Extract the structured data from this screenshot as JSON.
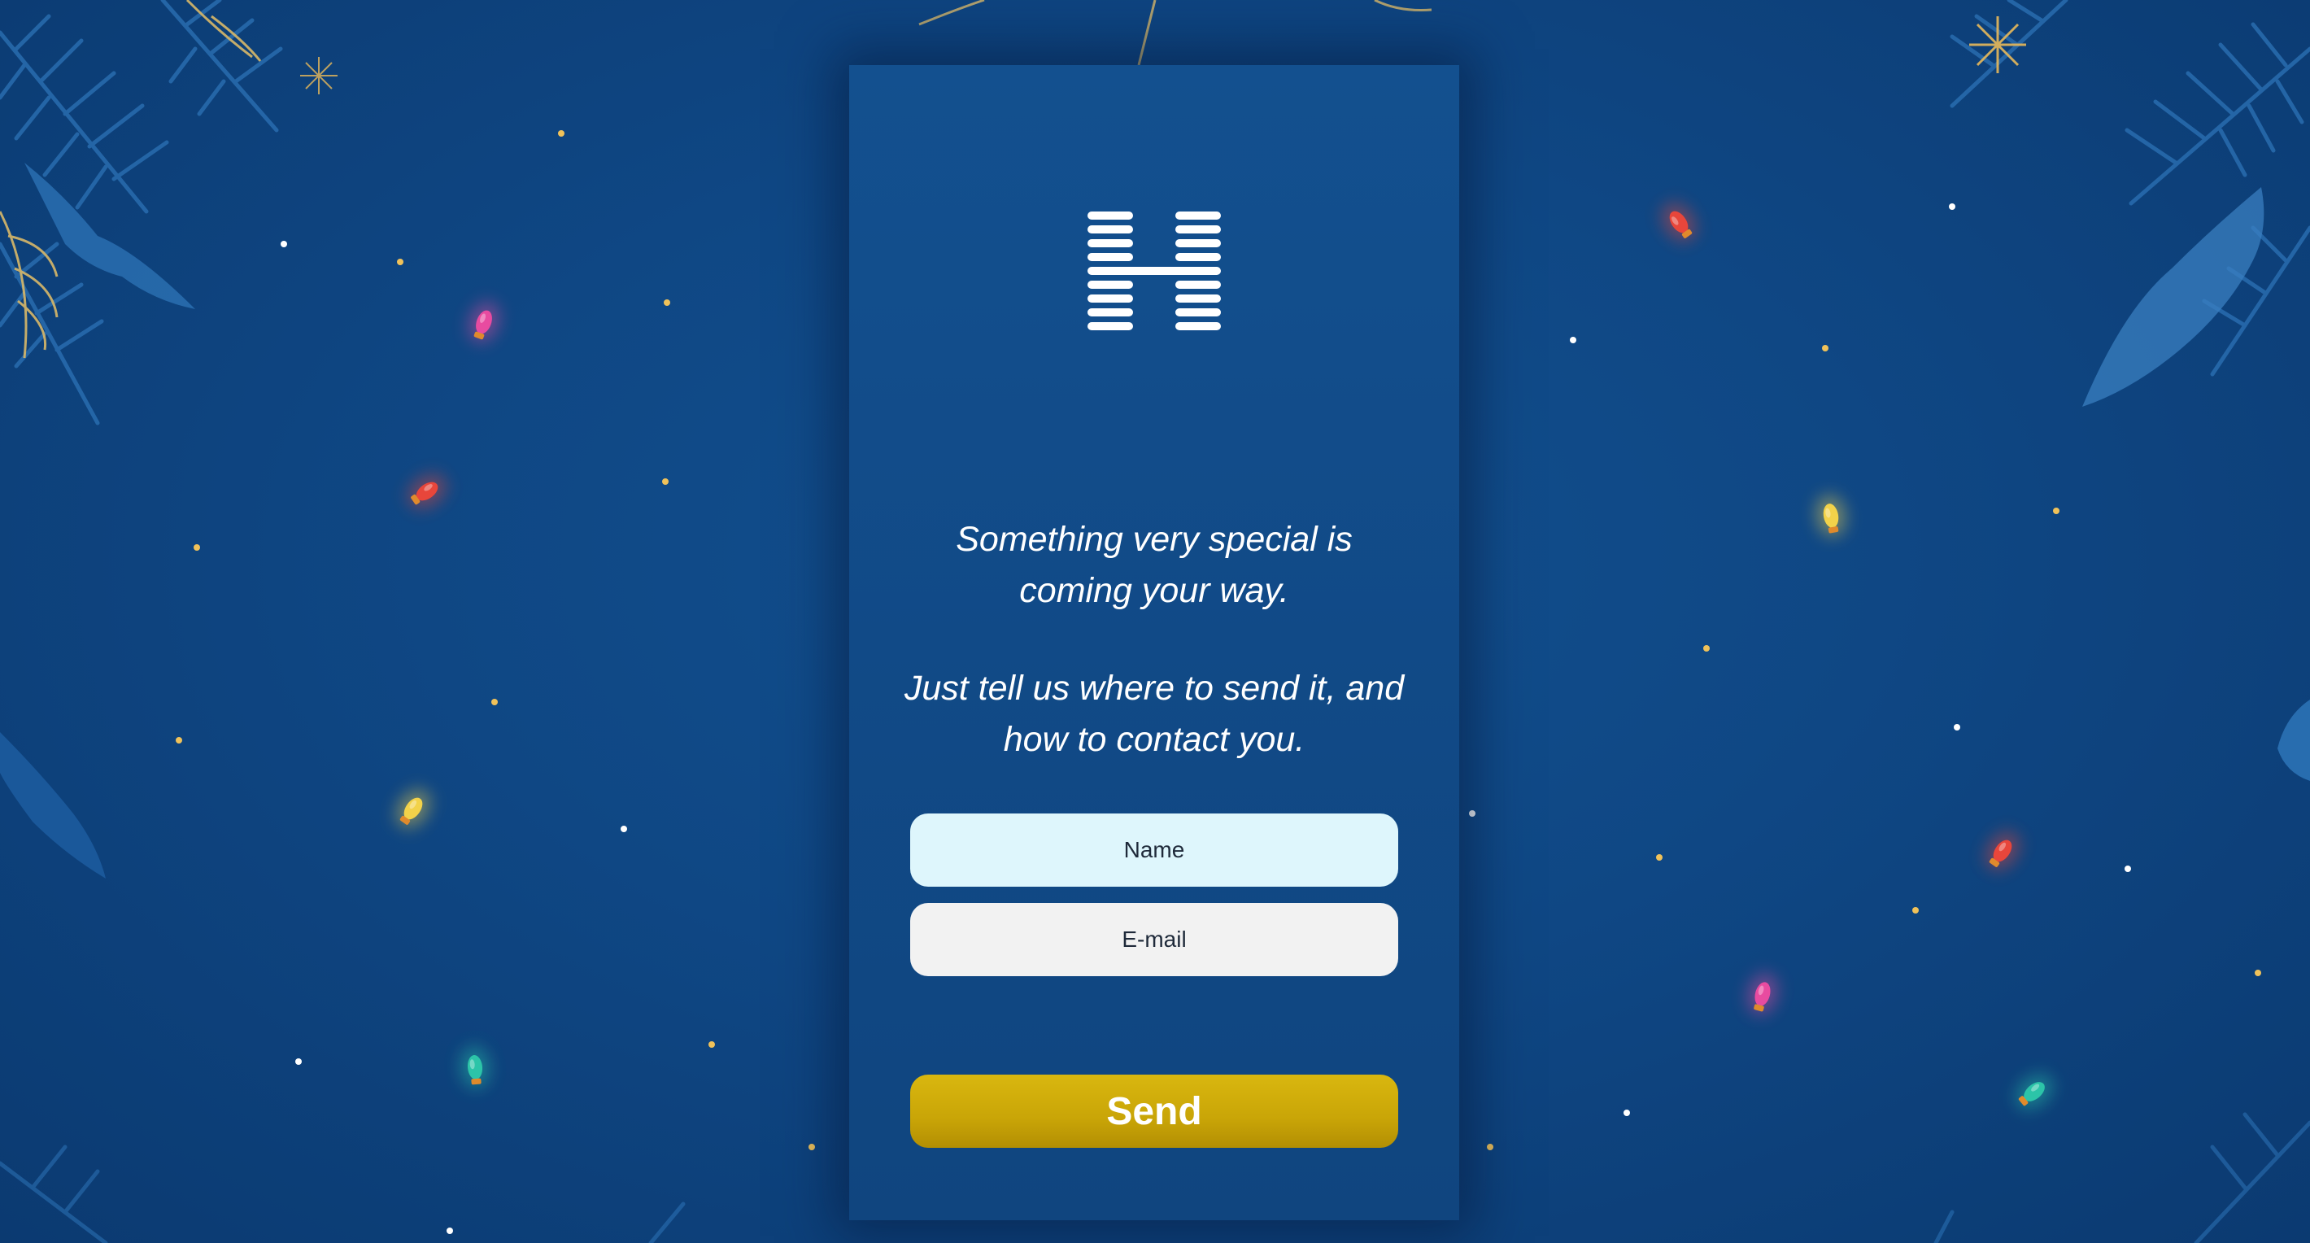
{
  "page": {
    "background_color": "#0f4784",
    "card_color": "#114a87"
  },
  "logo": {
    "icon": "striped-h-logo-icon"
  },
  "message": {
    "line1": "Something very special is coming your way.",
    "line2": "Just tell us where to send it, and how to contact you."
  },
  "form": {
    "name_placeholder": "Name",
    "email_placeholder": "E-mail",
    "send_label": "Send",
    "send_color": "#cca807"
  },
  "decorations": {
    "bulb_colors": [
      "#e8463b",
      "#e84ba0",
      "#f2d24a",
      "#2cc4a8"
    ],
    "snow_color": "#ffffff",
    "sparkle_color": "#f0c25a",
    "foliage_color": "#1c5a9c"
  }
}
